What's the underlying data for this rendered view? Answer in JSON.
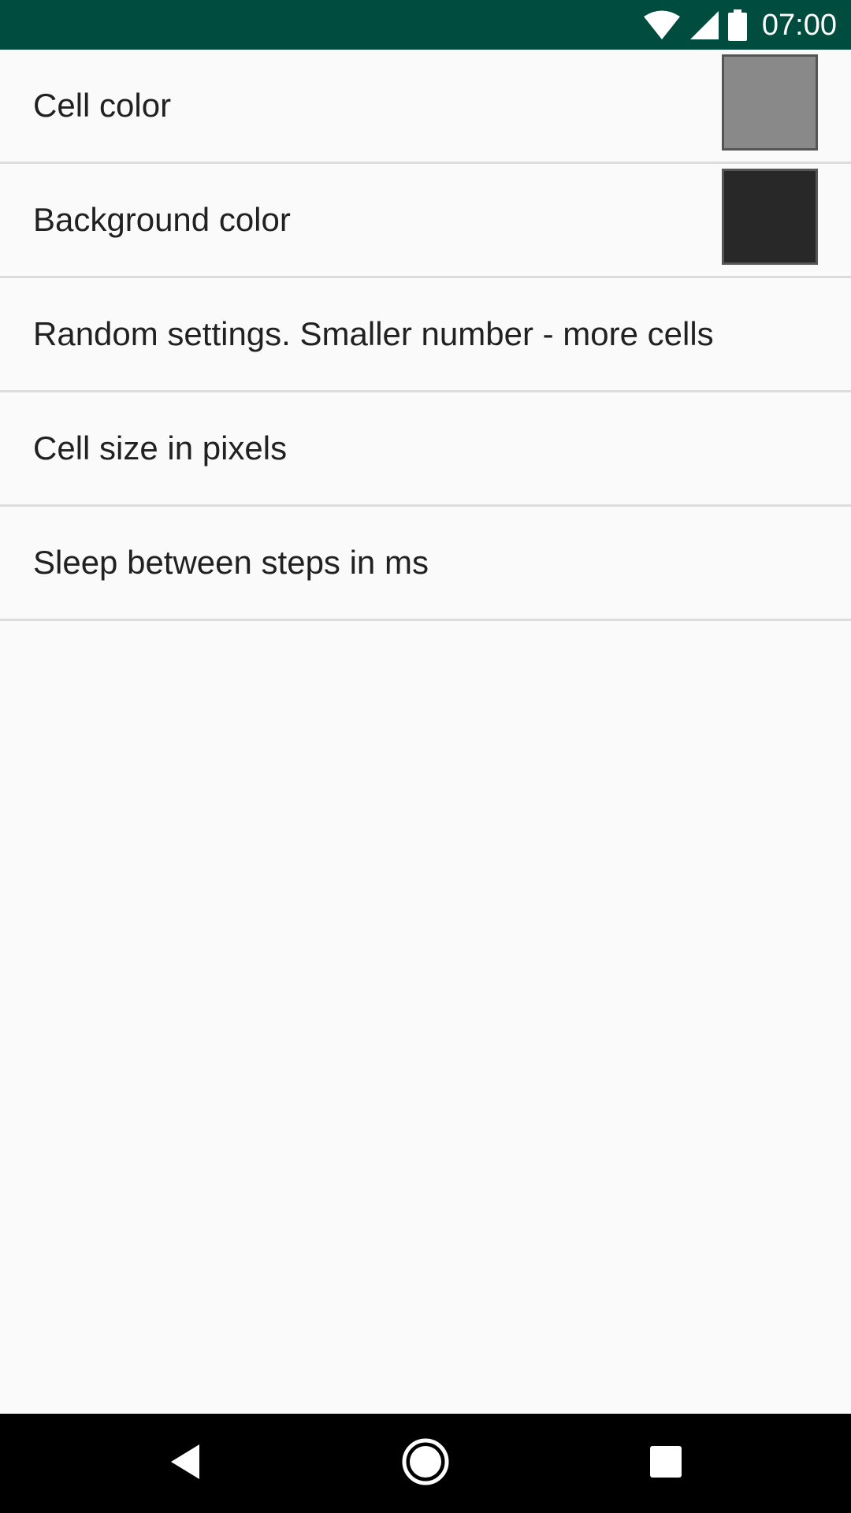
{
  "status_bar": {
    "time": "07:00",
    "icons": [
      "wifi-icon",
      "cell-signal-icon",
      "battery-icon"
    ],
    "background": "#004d40"
  },
  "preferences": [
    {
      "title": "Cell color",
      "swatch_color": "#898989"
    },
    {
      "title": "Background color",
      "swatch_color": "#282828"
    },
    {
      "title": "Random settings. Smaller number - more cells"
    },
    {
      "title": "Cell size in pixels"
    },
    {
      "title": "Sleep between steps in ms"
    }
  ],
  "nav_bar": {
    "buttons": [
      "back-icon",
      "home-icon",
      "recents-icon"
    ],
    "background": "#000000"
  }
}
